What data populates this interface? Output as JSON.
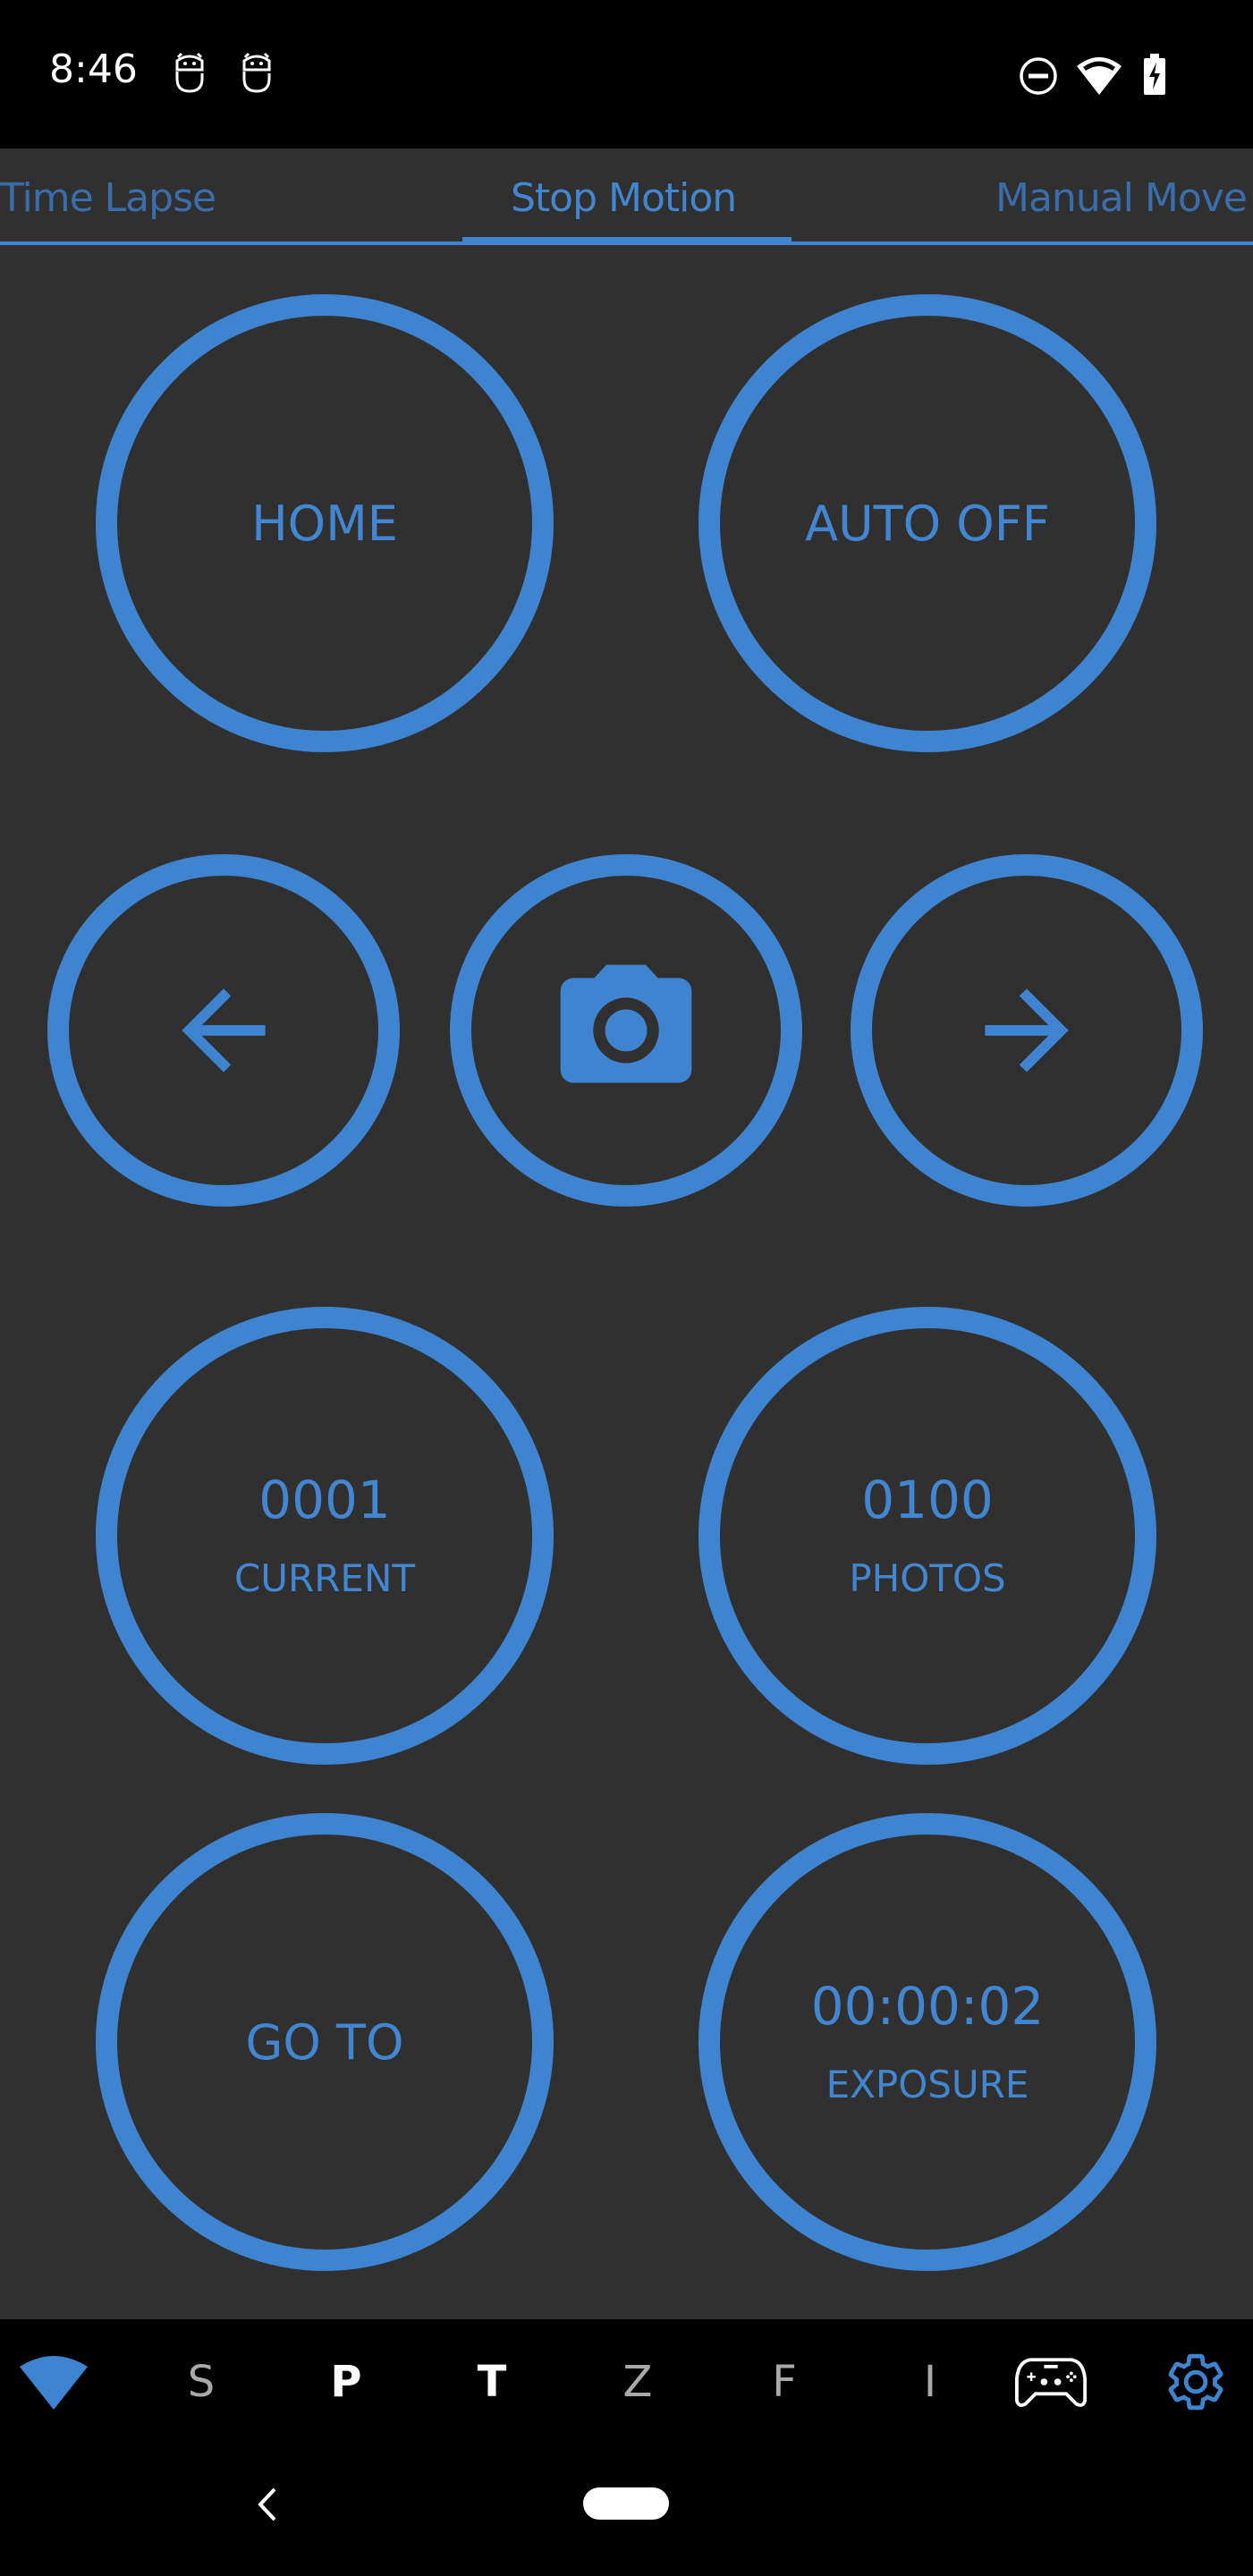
{
  "status_bar": {
    "time": "8:46",
    "left_icons": [
      "android-debug-icon",
      "android-debug-icon"
    ],
    "right_icons": [
      "do-not-disturb-icon",
      "wifi-icon",
      "battery-charging-icon"
    ]
  },
  "tabs": {
    "items": [
      {
        "label": "Time Lapse",
        "active": false
      },
      {
        "label": "Stop Motion",
        "active": true
      },
      {
        "label": "Manual Move",
        "active": false
      }
    ]
  },
  "controls": {
    "home_label": "HOME",
    "auto_off_label": "AUTO OFF",
    "prev_icon": "arrow-left-icon",
    "shutter_icon": "camera-icon",
    "next_icon": "arrow-right-icon",
    "current": {
      "value": "0001",
      "label": "CURRENT"
    },
    "photos": {
      "value": "0100",
      "label": "PHOTOS"
    },
    "goto_label": "GO TO",
    "exposure": {
      "value": "00:00:02",
      "label": "EXPOSURE"
    }
  },
  "bottom_nav": {
    "items": [
      {
        "type": "icon",
        "name": "wifi-signal-icon"
      },
      {
        "type": "letter",
        "label": "S",
        "style": "dim"
      },
      {
        "type": "letter",
        "label": "P",
        "style": "bright"
      },
      {
        "type": "letter",
        "label": "T",
        "style": "bright"
      },
      {
        "type": "letter",
        "label": "Z",
        "style": "dim"
      },
      {
        "type": "letter",
        "label": "F",
        "style": "dim"
      },
      {
        "type": "letter",
        "label": "I",
        "style": "dim"
      },
      {
        "type": "icon",
        "name": "gamepad-icon"
      },
      {
        "type": "icon",
        "name": "settings-gear-icon"
      }
    ]
  },
  "colors": {
    "accent": "#3f84d0",
    "background": "#303030",
    "bars": "#000000"
  }
}
